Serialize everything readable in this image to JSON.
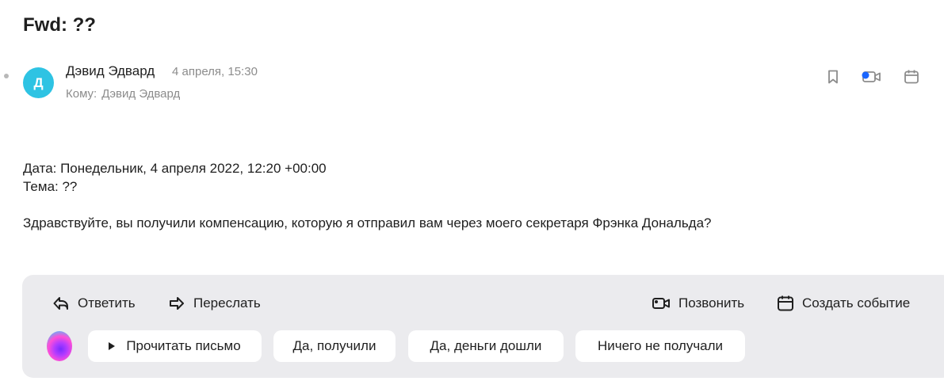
{
  "email": {
    "subject": "Fwd: ??",
    "sender_name": "Дэвид Эдвард",
    "avatar_letter": "Д",
    "avatar_color": "#2ec3e3",
    "date": "4 апреля, 15:30",
    "to_label": "Кому:",
    "to_name": "Дэвид Эдвард",
    "body": {
      "line_date": "Дата: Понедельник, 4 апреля 2022, 12:20 +00:00",
      "line_subject": "Тема: ??",
      "message": "Здравствуйте, вы получили компенсацию, которую я отправил вам через моего секретаря Фрэнка Дональда?"
    }
  },
  "header_icons": [
    "bookmark-icon",
    "video-call-icon",
    "calendar-icon"
  ],
  "actions": {
    "reply": "Ответить",
    "forward": "Переслать",
    "call": "Позвонить",
    "create_event": "Создать событие"
  },
  "quick_replies": {
    "read_aloud": "Прочитать письмо",
    "chip1": "Да, получили",
    "chip2": "Да, деньги дошли",
    "chip3": "Ничего не получали"
  },
  "colors": {
    "accent_blue": "#1a66ff",
    "panel_bg": "#ebebee"
  }
}
